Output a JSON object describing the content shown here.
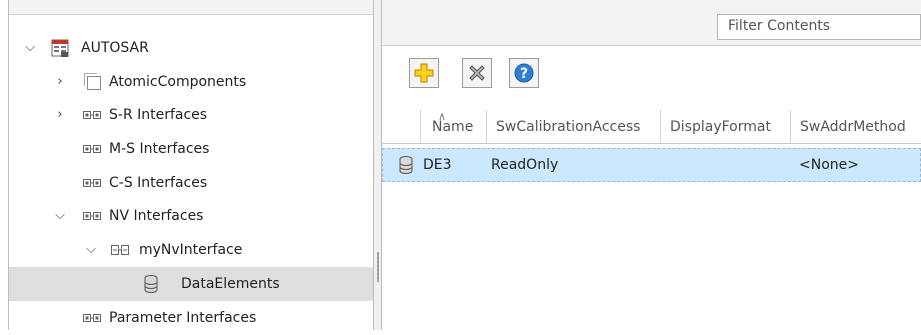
{
  "tree": {
    "root": {
      "label": "AUTOSAR",
      "icon": "autosar-package-icon"
    },
    "items": [
      {
        "label": "AtomicComponents",
        "icon": "component-icon"
      },
      {
        "label": "S-R Interfaces",
        "icon": "interface-icon"
      },
      {
        "label": "M-S Interfaces",
        "icon": "interface-icon"
      },
      {
        "label": "C-S Interfaces",
        "icon": "interface-icon"
      },
      {
        "label": "NV Interfaces",
        "icon": "interface-icon"
      },
      {
        "label": "myNvInterface",
        "icon": "nv-interface-icon"
      },
      {
        "label": "DataElements",
        "icon": "database-icon",
        "selected": true
      },
      {
        "label": "Parameter Interfaces",
        "icon": "interface-icon"
      }
    ]
  },
  "filter": {
    "placeholder": "Filter Contents"
  },
  "toolbar": {
    "add": {
      "icon": "add-plus-icon",
      "color": "#f5c400"
    },
    "delete": {
      "icon": "delete-x-icon"
    },
    "help": {
      "icon": "help-question-icon",
      "label": "?"
    }
  },
  "grid": {
    "columns": [
      "Name",
      "SwCalibrationAccess",
      "DisplayFormat",
      "SwAddrMethod"
    ],
    "rows": [
      {
        "icon": "database-icon",
        "name": "DE3",
        "access": "ReadOnly",
        "format": "",
        "method": "<None>"
      }
    ]
  },
  "colors": {
    "selection": "#cce8ff",
    "tree_selected": "#dedede"
  }
}
